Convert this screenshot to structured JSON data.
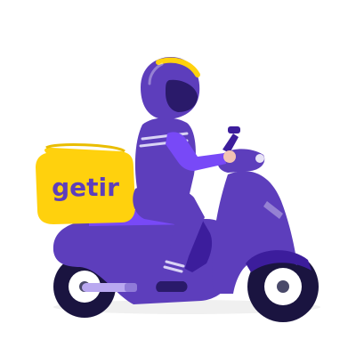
{
  "illustration": {
    "brand": {
      "logo_text": "getir"
    },
    "colors": {
      "primary_purple": "#5d3ebc",
      "light_purple": "#7849f7",
      "dark_purple": "#3c1d9c",
      "brand_yellow": "#ffd10d",
      "tire_black": "#1a1440",
      "rim_white": "#ffffff",
      "hub_gray": "#4a4a6a",
      "reflective_stripe": "#d9d3f5",
      "skin": "#f3c3b3"
    },
    "elements": {
      "rider": "courier-rider",
      "helmet": "helmet-icon",
      "scooter": "scooter-icon",
      "delivery_box": "delivery-box-icon"
    }
  }
}
